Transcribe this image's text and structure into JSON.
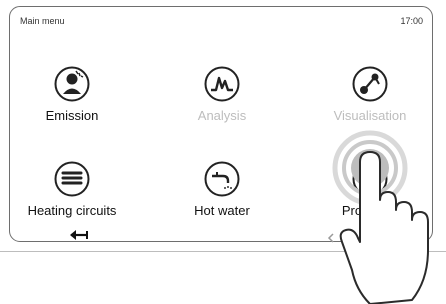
{
  "header": {
    "title": "Main menu",
    "time": "17:00"
  },
  "menu": {
    "tiles": [
      {
        "label": "Emission",
        "icon": "emission-icon",
        "enabled": true
      },
      {
        "label": "Analysis",
        "icon": "analysis-icon",
        "enabled": false
      },
      {
        "label": "Visualisation",
        "icon": "visualisation-icon",
        "enabled": false
      },
      {
        "label": "Heating circuits",
        "icon": "heating-circuits-icon",
        "enabled": true
      },
      {
        "label": "Hot water",
        "icon": "hot-water-icon",
        "enabled": true
      },
      {
        "label": "Programs",
        "icon": "programs-icon",
        "enabled": true
      }
    ]
  },
  "footer": {
    "back_icon": "back-arrow-icon",
    "page_prev_icon": "chevron-left-icon"
  },
  "overlay": {
    "pointer": "finger-tap-hand-icon"
  },
  "colors": {
    "frame": "#6e6e6e",
    "icon": "#222222",
    "disabled": "#bdbdbd",
    "tap_ring": "#d9d9d9"
  }
}
